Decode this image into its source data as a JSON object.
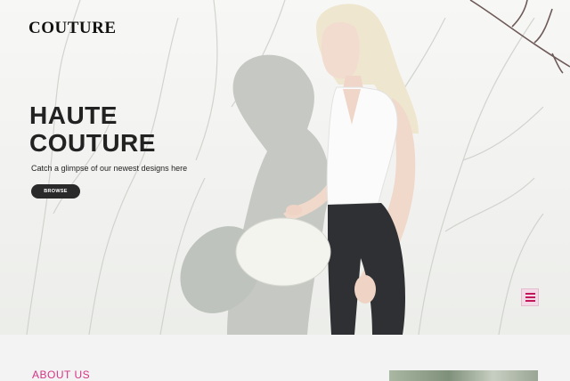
{
  "brand": {
    "logo": "COUTURE"
  },
  "hero": {
    "headline_line1": "HAUTE",
    "headline_line2": "COUTURE",
    "tagline": "Catch a glimpse of our newest designs here",
    "browse_label": "BROWSE"
  },
  "menu": {
    "icon": "hamburger-menu-icon"
  },
  "about": {
    "title": "ABOUT US"
  },
  "colors": {
    "accent": "#d63384",
    "button_dark": "#2a2a2a",
    "menu_bg": "#f4d9e6"
  }
}
